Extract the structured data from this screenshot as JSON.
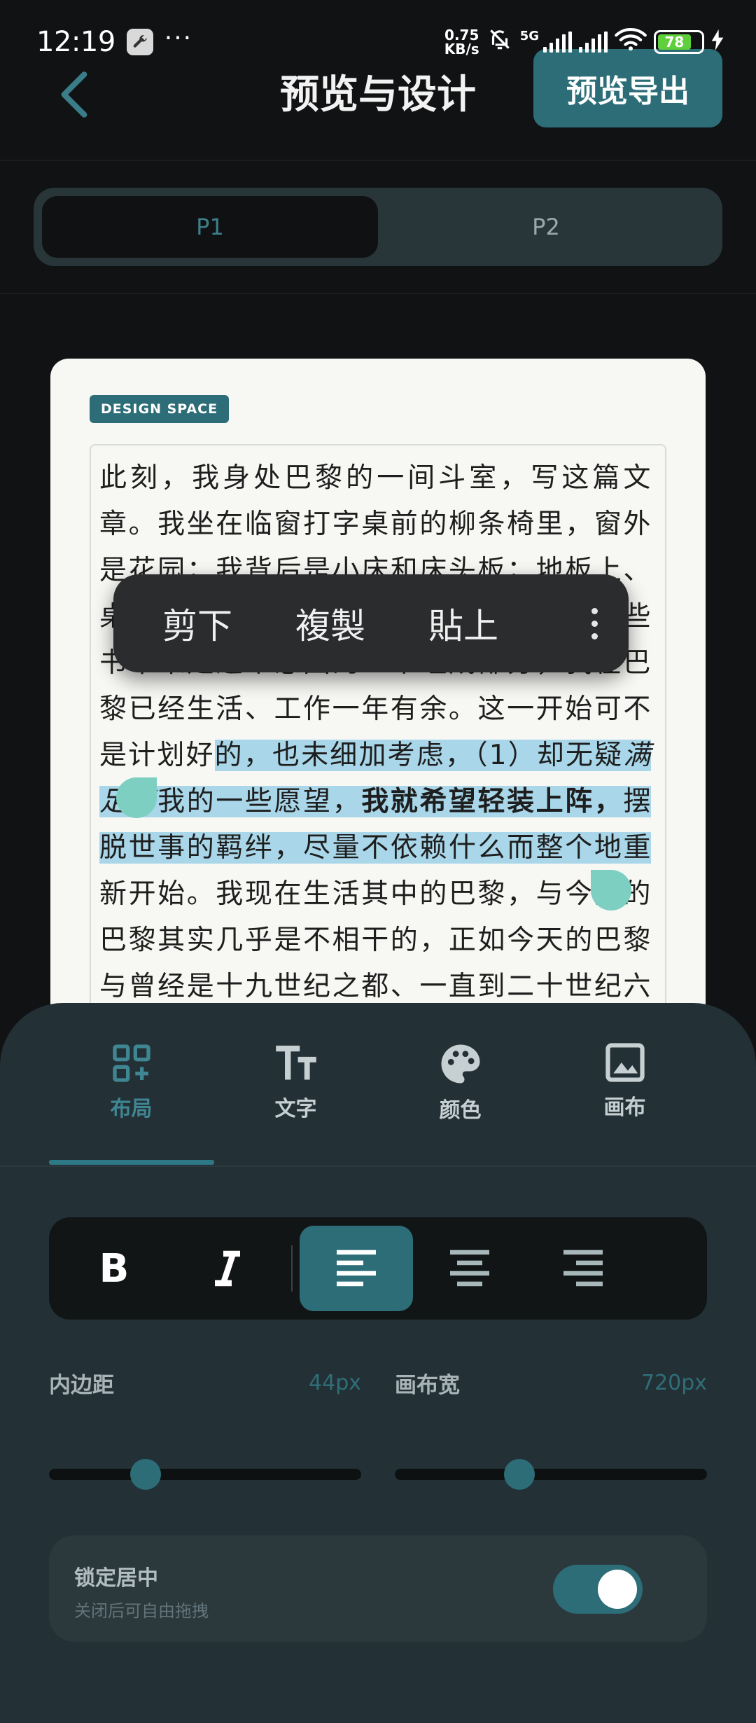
{
  "status_bar": {
    "time": "12:19",
    "app_icon": "wrench-icon",
    "more": "···",
    "speed_value": "0.75",
    "speed_unit": "KB/s",
    "network": "5G",
    "battery": "78"
  },
  "header": {
    "title": "预览与设计",
    "export_label": "预览导出"
  },
  "page_tabs": [
    {
      "label": "P1",
      "active": true
    },
    {
      "label": "P2",
      "active": false
    }
  ],
  "paper": {
    "tag": "DESIGN SPACE",
    "text": {
      "p1": "此刻，我身处巴黎的一间斗室，写这篇文章。我坐在临窗打字桌前的柳条椅里，窗外是花园；我背后是小床和床头板；地板上、桌子上堆满了书。我在这里一年多了，这些书本来是这个意图的一个组成部分，我在巴黎已经生活、工作一年有余。这一开始可不是计划好",
      "p2": "的，也未细加考虑，（1）却无疑",
      "italic": "满足了",
      "p3": "我的一些愿望，",
      "bold": "我就希望轻装上阵，",
      "p4": "摆脱世事的羁绊，尽量不依赖什么而整个地重",
      "p5": "新开始。我现在生活其中的巴黎，与今天的巴黎其实几乎是不相干的，正如今天的巴黎与曾经是十九世纪之都、一直到二十世纪六十年代"
    }
  },
  "context_menu": {
    "cut": "剪下",
    "copy": "複製",
    "paste": "貼上",
    "more_icon": "more-vertical-icon"
  },
  "tool_tabs": [
    {
      "label": "布局",
      "icon": "layout-grid-icon",
      "active": true
    },
    {
      "label": "文字",
      "icon": "text-size-icon",
      "active": false
    },
    {
      "label": "颜色",
      "icon": "palette-icon",
      "active": false
    },
    {
      "label": "画布",
      "icon": "image-icon",
      "active": false
    }
  ],
  "format_bar": {
    "bold": "B",
    "italic": "I",
    "active_align": "align-left"
  },
  "sliders": {
    "padding": {
      "label": "内边距",
      "value": "44px",
      "level": 0.31
    },
    "canvas_width": {
      "label": "画布宽",
      "value": "720px",
      "level": 0.4
    }
  },
  "lock_center": {
    "title": "锁定居中",
    "subtitle": "关闭后可自由拖拽",
    "on": true
  },
  "colors": {
    "accent": "#2c6d78",
    "sheet": "#233035",
    "selection": "#a9d7e9",
    "handle": "#7ccfc1"
  }
}
